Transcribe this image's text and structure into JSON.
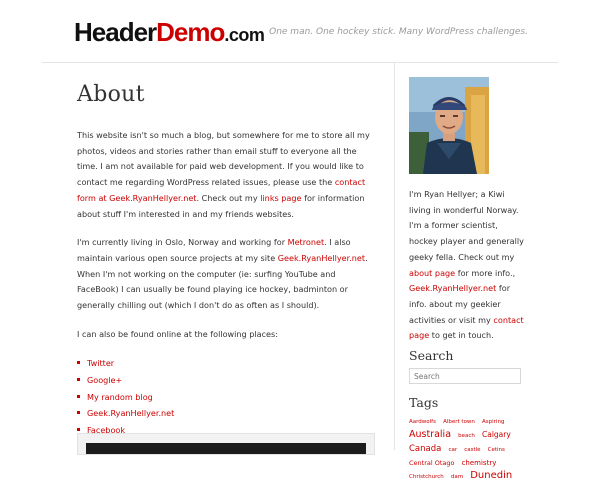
{
  "header": {
    "logo_part1": "Header",
    "logo_part2": "Demo",
    "logo_part3": ".com",
    "tagline": "One man. One hockey stick. Many WordPress challenges."
  },
  "main": {
    "title": "About",
    "p1": {
      "t1": "This website isn't so much a blog, but somewhere for me to store all my photos, videos and stories rather than email stuff to everyone all the time. I am not available for paid web development. If you would like to contact me regarding WordPress related issues, please use the ",
      "link1": "contact form at Geek.RyanHellyer.net",
      "t2": ". Check out my ",
      "link2": "links page",
      "t3": " for information about stuff I'm interested in and my friends websites."
    },
    "p2": {
      "t1": "I'm currently living in Oslo, Norway and working for ",
      "link1": "Metronet",
      "t2": ". I also maintain various open source projects at my site ",
      "link2": "Geek.RyanHellyer.net",
      "t3": ". When I'm not working on the computer (ie: surfing YouTube and FaceBook) I can usually be found playing ice hockey, badminton or generally chilling out (which I don't do as often as I should)."
    },
    "p3": "I can also be found online at the following places:",
    "links": [
      "Twitter",
      "Google+",
      "My random blog",
      "Geek.RyanHellyer.net",
      "Facebook"
    ]
  },
  "sidebar": {
    "bio": {
      "t1": "I'm Ryan Hellyer; a Kiwi living in wonderful Norway. I'm a former scientist, hockey player and generally geeky fella. Check out my ",
      "link1": "about page",
      "t2": " for more info., ",
      "link2": "Geek.RyanHellyer.net",
      "t3": " for info. about my geekier activities or visit my ",
      "link3": "contact page",
      "t4": " to get in touch."
    },
    "search_title": "Search",
    "search_placeholder": "Search",
    "tags_title": "Tags",
    "tags": [
      {
        "label": "Aardwolfs",
        "size": 5.5
      },
      {
        "label": "Albert town",
        "size": 5.5
      },
      {
        "label": "Aspiring",
        "size": 5.5
      },
      {
        "label": "Australia",
        "size": 9.5
      },
      {
        "label": "beach",
        "size": 5.5
      },
      {
        "label": "Calgary",
        "size": 7.5
      },
      {
        "label": "Canada",
        "size": 8.5
      },
      {
        "label": "car",
        "size": 5.5
      },
      {
        "label": "castle",
        "size": 5.5
      },
      {
        "label": "Cetins",
        "size": 5.5
      },
      {
        "label": "Central Otago",
        "size": 6.5
      },
      {
        "label": "chemistry",
        "size": 7
      },
      {
        "label": "Christchurch",
        "size": 5.5
      },
      {
        "label": "dam",
        "size": 5.5
      },
      {
        "label": "Dunedin",
        "size": 10
      }
    ]
  }
}
